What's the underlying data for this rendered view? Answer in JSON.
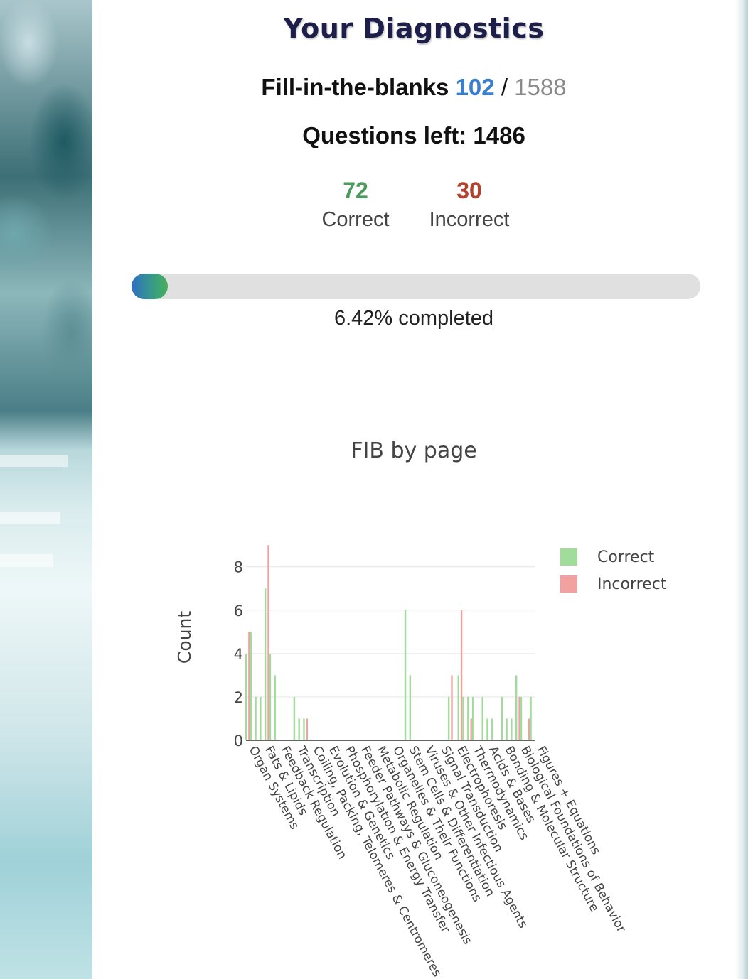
{
  "header": {
    "title": "Your Diagnostics",
    "fib_label": "Fill-in-the-blanks",
    "fib_done": "102",
    "fib_total": "1588",
    "questions_left_label": "Questions left:",
    "questions_left": "1486"
  },
  "stats": {
    "correct_count": "72",
    "correct_label": "Correct",
    "incorrect_count": "30",
    "incorrect_label": "Incorrect"
  },
  "progress": {
    "percent": 6.42,
    "text": "6.42% completed"
  },
  "colors": {
    "correct": "#a1dc9a",
    "incorrect": "#f2a1a1"
  },
  "chart_data": {
    "type": "bar",
    "title": "FIB by page",
    "xlabel": "",
    "ylabel": "Count",
    "ylim": [
      0,
      9.3
    ],
    "yticks": [
      0,
      2,
      4,
      6,
      8
    ],
    "legend_position": "top-right",
    "categories": [
      "Organ Systems",
      "Fats & Lipids",
      "Feedback Regulation",
      "Transcription",
      "Coiling, Packing, Telomeres & Centromeres",
      "Evolution & Genetics",
      "Phosphorylation & Energy Transfer",
      "Feeder Pathways & Gluconeogenesis",
      "Metabolic Regulation",
      "Organelles & Their Functions",
      "Stem Cells & Differentiation",
      "Viruses & Other Infectious Agents",
      "Signal Transduction",
      "Electrophoresis",
      "Thermodynamics",
      "Acids & Bases",
      "Bonding & Molecular Structure",
      "Biological Foundations of Behavior",
      "Figures + Equations"
    ],
    "bar_x": [
      0,
      0.5,
      1,
      1.5,
      2,
      2.5,
      3,
      3.5,
      4,
      4.5,
      5,
      5.5,
      6,
      6.5,
      7,
      7.5,
      8,
      8.5,
      9,
      9.5,
      10,
      10.5,
      11,
      11.5,
      12,
      12.5,
      13,
      13.5,
      14,
      14.5,
      15,
      15.5,
      16,
      16.5,
      17,
      17.5,
      18,
      18.5
    ],
    "series": [
      {
        "name": "Correct",
        "values": [
          4,
          5,
          2,
          2,
          7,
          4,
          3,
          0,
          0,
          0,
          2,
          1,
          1,
          0,
          0,
          0,
          0,
          0,
          0,
          0,
          0,
          0,
          0,
          0,
          0,
          0,
          0,
          0,
          0,
          0,
          0,
          0,
          0,
          6,
          3,
          0,
          0,
          0
        ]
      },
      {
        "name": "Incorrect",
        "values": [
          5,
          0,
          0,
          0,
          9,
          0,
          0,
          0,
          0,
          0,
          0,
          0,
          1,
          0,
          0,
          0,
          0,
          0,
          0,
          0,
          0,
          0,
          0,
          0,
          0,
          0,
          0,
          0,
          0,
          0,
          0,
          0,
          0,
          0,
          0,
          0,
          0,
          0
        ]
      }
    ],
    "tail": {
      "x": [
        21,
        21.5,
        22,
        22.5,
        23,
        23.5,
        24,
        24.5,
        25,
        25.5,
        26,
        26.5,
        27,
        27.5,
        28,
        28.5,
        29,
        29.5
      ],
      "correct": [
        2,
        0,
        3,
        2,
        2,
        2,
        0,
        2,
        1,
        1,
        0,
        2,
        1,
        1,
        3,
        2,
        0,
        2
      ],
      "incorrect": [
        3,
        0,
        6,
        0,
        1,
        0,
        0,
        0,
        0,
        0,
        0,
        0,
        0,
        0,
        2,
        0,
        1,
        0
      ]
    }
  }
}
